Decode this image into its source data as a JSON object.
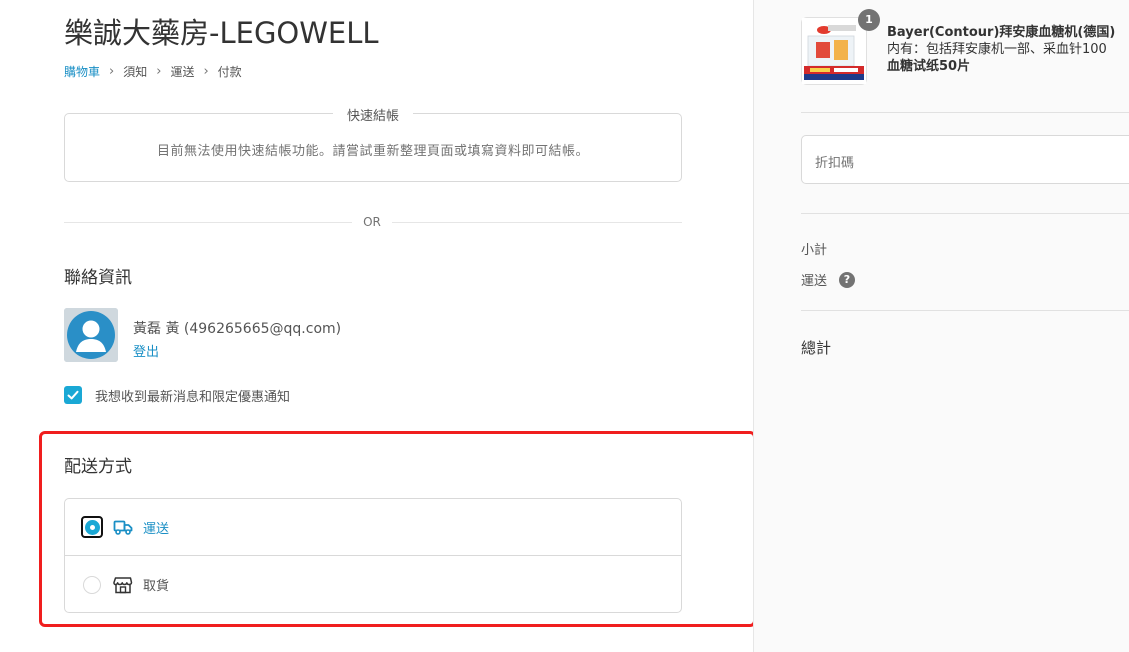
{
  "shop": {
    "title": "樂誠大藥房-LEGOWELL"
  },
  "breadcrumb": {
    "items": [
      "購物車",
      "須知",
      "運送",
      "付款"
    ],
    "separator": "›"
  },
  "express_checkout": {
    "title": "快速結帳",
    "message": "目前無法使用快速結帳功能。請嘗試重新整理頁面或填寫資料即可結帳。"
  },
  "divider": {
    "or_text": "OR"
  },
  "contact": {
    "heading": "聯絡資訊",
    "user_display": "黃磊 黃 (496265665@qq.com)",
    "logout_label": "登出",
    "newsletter_label": "我想收到最新消息和限定優惠通知",
    "newsletter_checked": true
  },
  "delivery": {
    "heading": "配送方式",
    "options": [
      {
        "label": "運送",
        "icon": "truck-icon",
        "selected": true
      },
      {
        "label": "取貨",
        "icon": "store-icon",
        "selected": false
      }
    ]
  },
  "summary": {
    "product": {
      "quantity": "1",
      "name_line1": "Bayer(Contour)拜安康血糖机(德国)",
      "name_line2": "内有：包括拜安康机一部、采血针100",
      "name_line3": "血糖试纸50片"
    },
    "discount_placeholder": "折扣碼",
    "subtotal_label": "小計",
    "shipping_label": "運送",
    "total_label": "總計",
    "help_icon_glyph": "?"
  },
  "colors": {
    "accent": "#1aa8d5",
    "link": "#1a8fc5",
    "highlight_border": "#f01e1e",
    "sidebar_bg": "#fafafa"
  }
}
